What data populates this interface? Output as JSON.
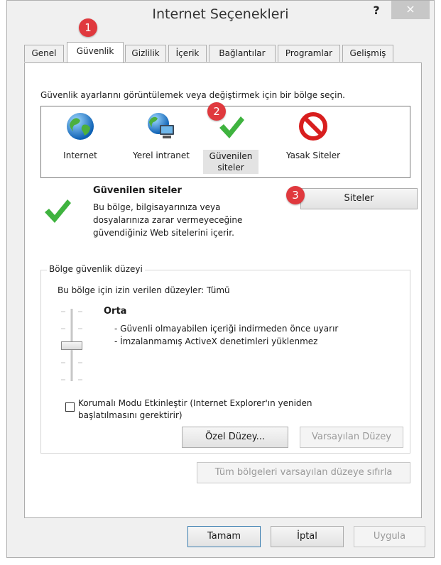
{
  "window": {
    "title": "Internet Seçenekleri",
    "help_label": "?",
    "close_label": "×"
  },
  "tabs": [
    {
      "label": "Genel"
    },
    {
      "label": "Güvenlik"
    },
    {
      "label": "Gizlilik"
    },
    {
      "label": "İçerik"
    },
    {
      "label": "Bağlantılar"
    },
    {
      "label": "Programlar"
    },
    {
      "label": "Gelişmiş"
    }
  ],
  "security": {
    "instruction": "Güvenlik ayarlarını görüntülemek veya değiştirmek için bir bölge seçin.",
    "zones": [
      {
        "label": "Internet",
        "icon": "globe-icon"
      },
      {
        "label": "Yerel intranet",
        "icon": "intranet-icon"
      },
      {
        "label": "Güvenilen siteler",
        "icon": "checkmark-icon",
        "selected": true
      },
      {
        "label": "Yasak Siteler",
        "icon": "restricted-icon"
      }
    ],
    "zone_title": "Güvenilen siteler",
    "zone_description": [
      "Bu bölge, bilgisayarınıza veya",
      "dosyalarınıza zarar vermeyeceğine",
      "güvendiğiniz Web sitelerini içerir."
    ],
    "sites_button": "Siteler",
    "level_group_title": "Bölge güvenlik düzeyi",
    "allowed_levels": "Bu bölge için izin verilen düzeyler: Tümü",
    "level_name": "Orta",
    "level_items": [
      "- Güvenli olmayabilen içeriği indirmeden önce uyarır",
      "- İmzalanmamış ActiveX denetimleri yüklenmez"
    ],
    "protected_mode_line1": "Korumalı Modu Etkinleştir (Internet Explorer'ın yeniden",
    "protected_mode_line2": "başlatılmasını gerektirir)",
    "custom_level_button": "Özel Düzey...",
    "default_level_button": "Varsayılan Düzey",
    "reset_all_button": "Tüm bölgeleri varsayılan düzeye sıfırla"
  },
  "footer": {
    "ok": "Tamam",
    "cancel": "İptal",
    "apply": "Uygula"
  },
  "markers": [
    "1",
    "2",
    "3"
  ],
  "colors": {
    "marker": "#e0393e",
    "check": "#3fb33f",
    "restricted": "#d81e1e"
  }
}
